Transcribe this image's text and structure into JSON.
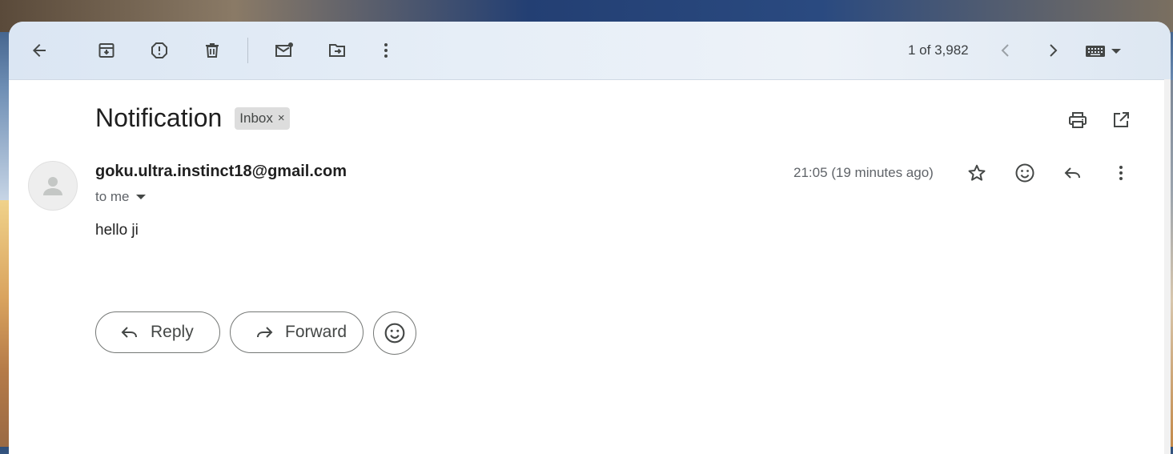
{
  "toolbar": {
    "pagination": "1 of 3,982",
    "icons": [
      "back-arrow-icon",
      "archive-icon",
      "report-spam-icon",
      "delete-icon",
      "mark-unread-icon",
      "move-to-icon",
      "more-vert-icon",
      "chevron-left-icon",
      "chevron-right-icon",
      "keyboard-icon",
      "caret-down-icon"
    ]
  },
  "message": {
    "subject": "Notification",
    "label": "Inbox",
    "label_remove": "×",
    "sender": "goku.ultra.instinct18@gmail.com",
    "recipient_summary": "to me",
    "timestamp": "21:05 (19 minutes ago)",
    "body": "hello ji"
  },
  "actions": {
    "reply_label": "Reply",
    "forward_label": "Forward"
  },
  "colors": {
    "toolbar_bg": "#e6eef7",
    "text_primary": "#1f1f1f",
    "text_secondary": "#5f6368",
    "chip_bg": "#dddddd",
    "button_border": "#747775"
  }
}
